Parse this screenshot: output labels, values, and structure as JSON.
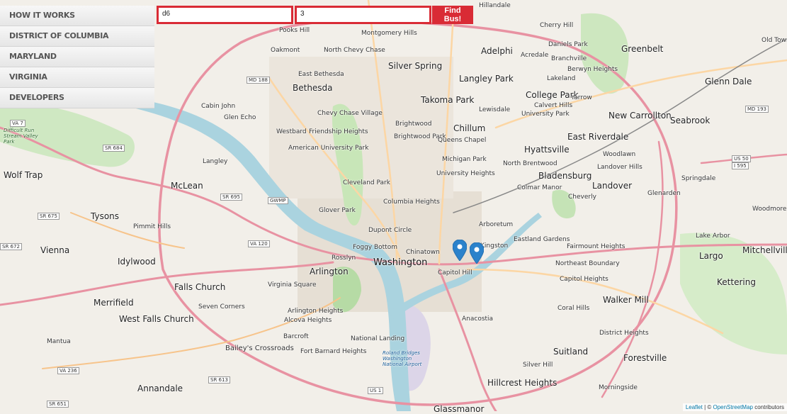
{
  "menu": {
    "items": [
      {
        "label": "HOW IT WORKS"
      },
      {
        "label": "DISTRICT OF COLUMBIA"
      },
      {
        "label": "MARYLAND"
      },
      {
        "label": "VIRGINIA"
      },
      {
        "label": "DEVELOPERS"
      }
    ]
  },
  "search": {
    "route_value": "d6",
    "stop_value": "3",
    "button_label": "Find Bus!"
  },
  "map": {
    "labels": {
      "washington": "Washington",
      "bethesda": "Bethesda",
      "silver_spring": "Silver Spring",
      "arlington": "Arlington",
      "mclean": "McLean",
      "tysons": "Tysons",
      "vienna": "Vienna",
      "falls_church": "Falls Church",
      "merrifield": "Merrifield",
      "idylwood": "Idylwood",
      "west_falls_church": "West Falls Church",
      "annandale": "Annandale",
      "baileys": "Bailey's Crossroads",
      "alexandria_fairfax": "Fort Barnard Heights",
      "anacostia": "Anacostia",
      "capitol_hill": "Capitol Hill",
      "chinatown": "Chinatown",
      "dupont": "Dupont Circle",
      "columbia_heights": "Columbia Heights",
      "cleveland_park": "Cleveland Park",
      "glover_park": "Glover Park",
      "foggy_bottom": "Foggy Bottom",
      "rosslyn": "Rosslyn",
      "brightwood": "Brightwood",
      "brightwood_park": "Brightwood Park",
      "takoma_park": "Takoma Park",
      "langley_park": "Langley Park",
      "adelphi": "Adelphi",
      "college_park": "College Park",
      "greenbelt": "Greenbelt",
      "new_carrollton": "New Carrollton",
      "seabrook": "Seabrook",
      "glenn_dale": "Glenn Dale",
      "hyattsville": "Hyattsville",
      "east_riverdale": "East Riverdale",
      "bladensburg": "Bladensburg",
      "landover": "Landover",
      "largo": "Largo",
      "mitchellville": "Mitchellville",
      "kettering": "Kettering",
      "walker_mill": "Walker Mill",
      "suitland": "Suitland",
      "forestville": "Forestville",
      "hillcrest_heights": "Hillcrest Heights",
      "glassmanor": "Glassmanor",
      "national_landing": "National Landing",
      "wolf_trap": "Wolf Trap",
      "chillum": "Chillum",
      "arboretum": "Arboretum",
      "eastland_gardens": "Eastland Gardens",
      "northeast_boundary": "Northeast Boundary",
      "queens_chapel": "Queens Chapel",
      "michigan_park": "Michigan Park",
      "university_heights": "University Heights",
      "friendship_heights": "Friendship Heights",
      "chevy_chase_village": "Chevy Chase Village",
      "american_university_park": "American University Park",
      "virginia_square": "Virginia Square",
      "arlington_heights": "Arlington Heights",
      "alcova_heights": "Alcova Heights",
      "barcroft": "Barcroft",
      "mantua": "Mantua",
      "pimmit_hills": "Pimmit Hills",
      "langley": "Langley",
      "westbard": "Westbard",
      "pooks_hill": "Pooks Hill",
      "montgomery_hills": "Montgomery Hills",
      "oakmont": "Oakmont",
      "north_chevy_chase": "North Chevy Chase",
      "east_bethesda": "East Bethesda",
      "cabin_john": "Cabin John",
      "glen_echo": "Glen Echo",
      "hillandale": "Hillandale",
      "cherry_hill": "Cherry Hill",
      "daniels_park": "Daniels Park",
      "branchville": "Branchville",
      "berwyn_heights": "Berwyn Heights",
      "lakeland": "Lakeland",
      "calvert_hills": "Calvert Hills",
      "yarrow": "Yarrow",
      "university_park": "University Park",
      "woodlawn": "Woodlawn",
      "landover_hills": "Landover Hills",
      "springdale": "Springdale",
      "glenarden": "Glenarden",
      "woodmore": "Woodmore",
      "lake_arbor": "Lake Arbor",
      "cheverly": "Cheverly",
      "fairmount_heights": "Fairmount Heights",
      "capitol_heights": "Capitol Heights",
      "coral_hills": "Coral Hills",
      "district_heights": "District Heights",
      "silver_hill": "Silver Hill",
      "morningside": "Morningside",
      "old_town": "Old Town",
      "acredale": "Acredale",
      "lewisdale": "Lewisdale",
      "north_brentwood": "North Brentwood",
      "colmar_manor": "Colmar Manor",
      "kingston": "Kingston",
      "seven_corners": "Seven Corners",
      "difficult_run": "Difficult Run Stream Valley Park",
      "kenilworth": "Roland Bridges Washington National Airport"
    },
    "routes": {
      "md_188": "MD 188",
      "md_193": "MD 193",
      "va_7": "VA 7",
      "sr_684": "SR 684",
      "sr_675": "SR 675",
      "va_672": "SR 672",
      "sr_695": "SR 695",
      "va_120": "VA 120",
      "va_236": "VA 236",
      "sr_613": "SR 613",
      "sr_651": "SR 651",
      "us_1": "US 1",
      "us_50": "US 50",
      "i_595": "I 595",
      "gwmp": "GWMP"
    }
  },
  "attribution": {
    "leaflet": "Leaflet",
    "separator": " | © ",
    "osm": "OpenStreetMap",
    "suffix": " contributors"
  }
}
